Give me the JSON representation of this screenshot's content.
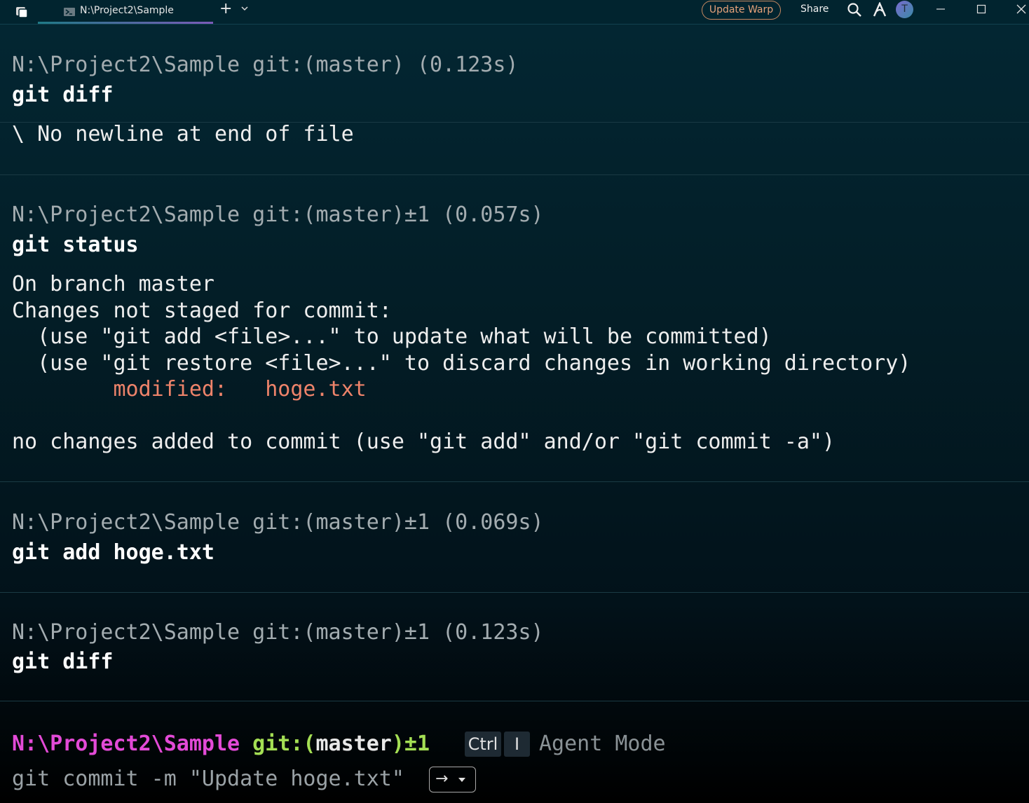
{
  "titlebar": {
    "tab_title": "N:\\Project2\\Sample",
    "new_tab": "+",
    "update_label": "Update Warp",
    "share_label": "Share",
    "avatar_initial": "T"
  },
  "blocks": [
    {
      "prompt": "N:\\Project2\\Sample git:(master) (0.123s)",
      "command": "git diff",
      "output": [
        "\\ No newline at end of file"
      ]
    },
    {
      "prompt": "N:\\Project2\\Sample git:(master)±1 (0.057s)",
      "command": "git status",
      "output": [
        "On branch master",
        "Changes not staged for commit:",
        "  (use \"git add <file>...\" to update what will be committed)",
        "  (use \"git restore <file>...\" to discard changes in working directory)"
      ],
      "modified_label": "        modified:   hoge.txt",
      "output_end": "no changes added to commit (use \"git add\" and/or \"git commit -a\")"
    },
    {
      "prompt": "N:\\Project2\\Sample git:(master)±1 (0.069s)",
      "command": "git add hoge.txt"
    },
    {
      "prompt": "N:\\Project2\\Sample git:(master)±1 (0.123s)",
      "command": "git diff"
    }
  ],
  "active_prompt": {
    "path": "N:\\Project2\\Sample",
    "git_open": "git:(",
    "branch": "master",
    "git_close": ")±1",
    "key_ctrl": "Ctrl",
    "key_i": "I",
    "agent_mode": "Agent Mode",
    "suggestion": "git commit -m \"Update hoge.txt\"",
    "accept_label": "→"
  },
  "colors": {
    "path": "#e34ad7",
    "git": "#a4df54",
    "modified": "#ee836a",
    "update_accent": "#e7a27a"
  }
}
